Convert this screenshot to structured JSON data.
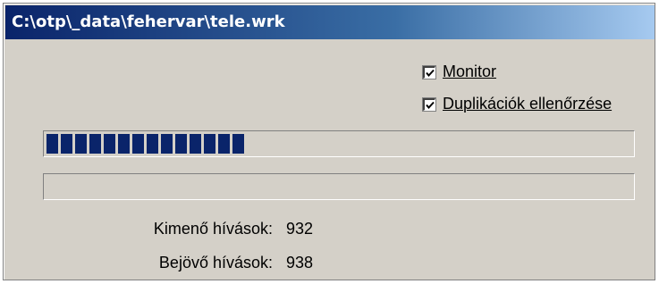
{
  "window": {
    "title": "C:\\otp\\_data\\fehervar\\tele.wrk"
  },
  "options": {
    "monitor": {
      "label": "Monitor",
      "checked": true
    },
    "duplicate_check": {
      "label": "Duplikációk ellenőrzése",
      "checked": true
    }
  },
  "progress": {
    "primary_fraction": 0.34,
    "secondary_fraction": 0.0
  },
  "stats": {
    "outgoing_label": "Kimenő hívások:",
    "outgoing_value": "932",
    "incoming_label": "Bejövő hívások:",
    "incoming_value": "938"
  },
  "colors": {
    "titlebar_start": "#0a246a",
    "titlebar_end": "#a6caf0",
    "progress_fill": "#0a246a",
    "face": "#d4d0c8"
  }
}
